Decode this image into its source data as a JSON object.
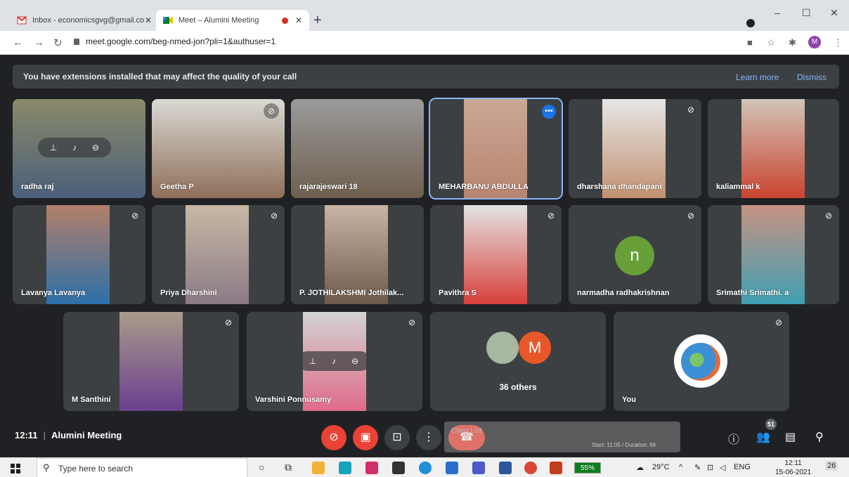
{
  "browser": {
    "tabs": [
      {
        "title": "Inbox - economicsgvg@gmail.co",
        "close": "✕"
      },
      {
        "title": "Meet – Alumini Meeting",
        "close": "✕"
      }
    ],
    "new_tab": "+",
    "window_controls": [
      "–",
      "☐",
      "✕"
    ],
    "url": "meet.google.com/beg-nmed-jon?pli=1&authuser=1",
    "profile_initial": "M"
  },
  "banner": {
    "message": "You have extensions installed that may affect the quality of your call",
    "learn_more": "Learn more",
    "dismiss": "Dismiss"
  },
  "participants": [
    {
      "name": "radha raj"
    },
    {
      "name": "Geetha P"
    },
    {
      "name": "rajarajeswari 18"
    },
    {
      "name": "MEHARBANU ABDULLA"
    },
    {
      "name": "dharshana dhandapani"
    },
    {
      "name": "kaliammal k"
    },
    {
      "name": "Lavanya Lavanya"
    },
    {
      "name": "Priya Dharshini"
    },
    {
      "name": "P. JOTHILAKSHMI Jothilak..."
    },
    {
      "name": "Pavithra S"
    },
    {
      "name": "narmadha radhakrishnan",
      "initial": "n"
    },
    {
      "name": "Srimathi Srimathi. a"
    },
    {
      "name": "M Santhini"
    },
    {
      "name": "Varshini Ponnusamy"
    },
    {
      "name": "36 others",
      "initial": "M"
    },
    {
      "name": "You"
    }
  ],
  "bottom": {
    "time": "12:11",
    "meeting_title": "Alumini Meeting",
    "participant_count": "51",
    "overlay_text": "Class List",
    "overlay_sub": "Start: 11:05 / Duration: 66"
  },
  "taskbar": {
    "search_placeholder": "Type here to search",
    "battery": "55%",
    "temperature": "29°C",
    "language": "ENG",
    "time": "12:11",
    "date": "15-06-2021",
    "notifications": "26"
  },
  "colors": {
    "meet_bg": "#202124",
    "tile_bg": "#3c4043",
    "red_button": "#ea4335",
    "accent_blue": "#8ab4f8"
  }
}
